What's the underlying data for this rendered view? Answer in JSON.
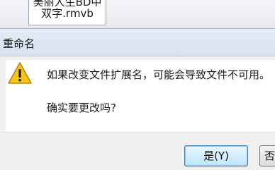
{
  "desktop": {
    "file_name_line1": "美丽人生BD中英",
    "file_name_line2": "双字.rmvb"
  },
  "dialog": {
    "title": "重命名",
    "icon": "warning-icon",
    "message": "如果改变文件扩展名，可能会导致文件不可用。",
    "question": "确实要更改吗?",
    "buttons": {
      "yes_label": "是(Y)",
      "no_label": "否"
    }
  },
  "colors": {
    "warning_fill": "#f5c518",
    "warning_border": "#b8860b",
    "primary_button_border": "#3c7fb1"
  }
}
